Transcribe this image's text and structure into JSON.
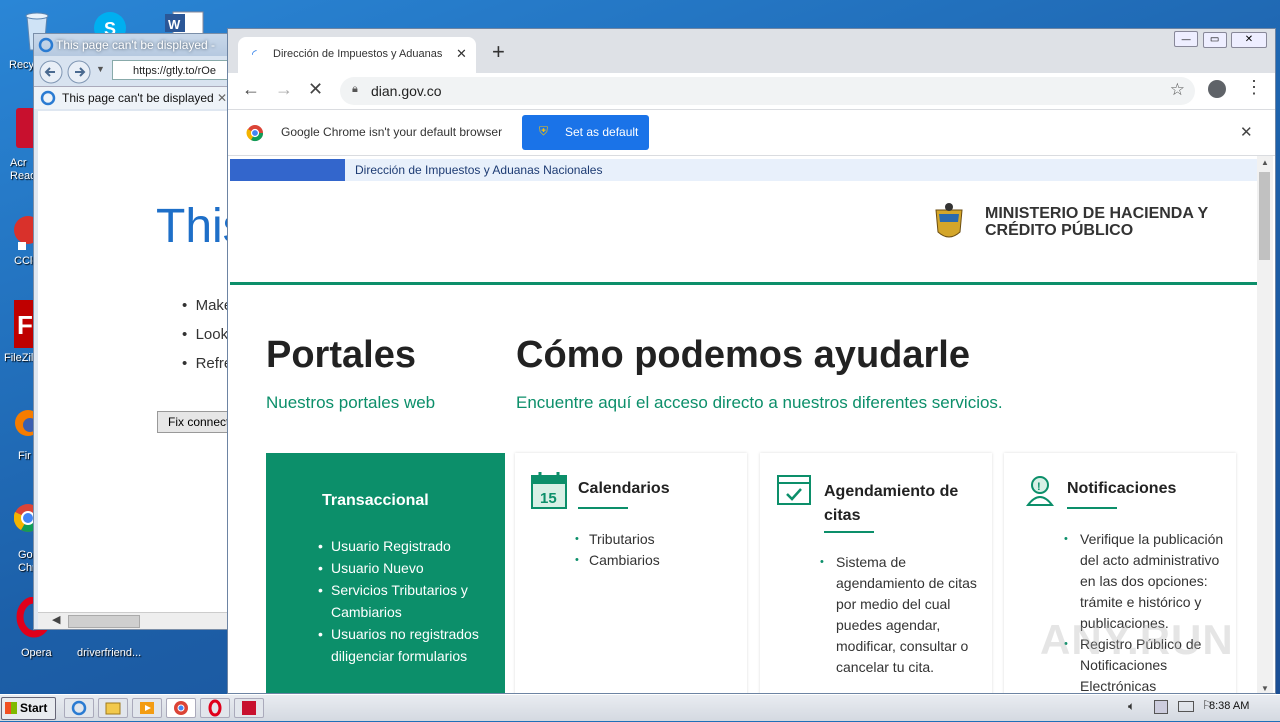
{
  "desktop": {
    "icons": [
      {
        "label": "Recy"
      },
      {
        "label": "Acr\nRead"
      },
      {
        "label": "CCle"
      },
      {
        "label": "FileZill"
      },
      {
        "label": "Fir"
      },
      {
        "label": "Go\nChr"
      },
      {
        "label": "Opera"
      },
      {
        "label": "driverfriend..."
      }
    ]
  },
  "ie": {
    "title": "This page can't be displayed -",
    "url": "https://gtly.to/rOe",
    "tab_label": "This page can't be displayed",
    "heading": "This",
    "bullets": [
      "Make",
      "Look",
      "Refre"
    ],
    "fix_button": "Fix connect"
  },
  "chrome": {
    "tab_title": "Dirección de Impuestos y Aduanas N",
    "url": "dian.gov.co",
    "infobar": {
      "message": "Google Chrome isn't your default browser",
      "button": "Set as default"
    }
  },
  "page": {
    "top_strip_text": "Dirección de Impuestos y Aduanas Nacionales",
    "ministry": "MINISTERIO DE HACIENDA Y\nCRÉDITO PÚBLICO",
    "portales_title": "Portales",
    "portales_sub": "Nuestros portales web",
    "ayudarle_title": "Cómo podemos ayudarle",
    "ayudarle_sub": "Encuentre aquí el acceso directo a nuestros diferentes servicios.",
    "transaccional": {
      "title": "Transaccional",
      "items": [
        "Usuario Registrado",
        "Usuario Nuevo",
        "Servicios Tributarios y Cambiarios",
        "Usuarios no registrados diligenciar formularios"
      ]
    },
    "calendarios": {
      "title": "Calendarios",
      "icon_number": "15",
      "items": [
        "Tributarios",
        "Cambiarios"
      ]
    },
    "agendamiento": {
      "title": "Agendamiento de citas",
      "items": [
        "Sistema de agendamiento de citas por medio del cual puedes agendar, modificar, consultar o cancelar tu cita."
      ]
    },
    "notificaciones": {
      "title": "Notificaciones",
      "items": [
        "Verifique la publicación del acto administrativo en las dos opciones: trámite e histórico y publicaciones.",
        "Registro Público de Notificaciones Electrónicas"
      ]
    },
    "brand_color": "#0c8f6a"
  },
  "watermark": "ANY.RUN",
  "taskbar": {
    "start_label": "Start",
    "clock": "8:38 AM"
  }
}
